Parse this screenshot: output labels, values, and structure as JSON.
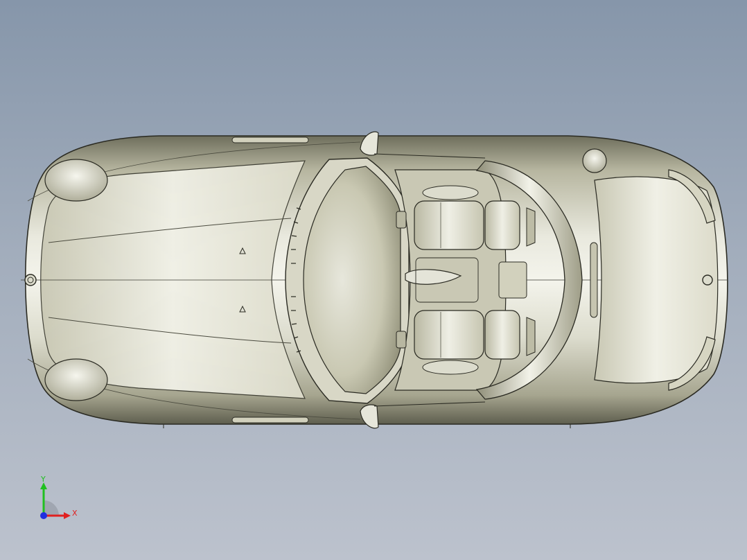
{
  "viewport": {
    "background_top": "#8696aa",
    "background_bottom": "#bcc2cd",
    "model": "roadster-top-view"
  },
  "triad": {
    "x_label": "X",
    "y_label": "Y",
    "x_color": "#e02020",
    "y_color": "#20c020",
    "z_color": "#2030e0"
  }
}
